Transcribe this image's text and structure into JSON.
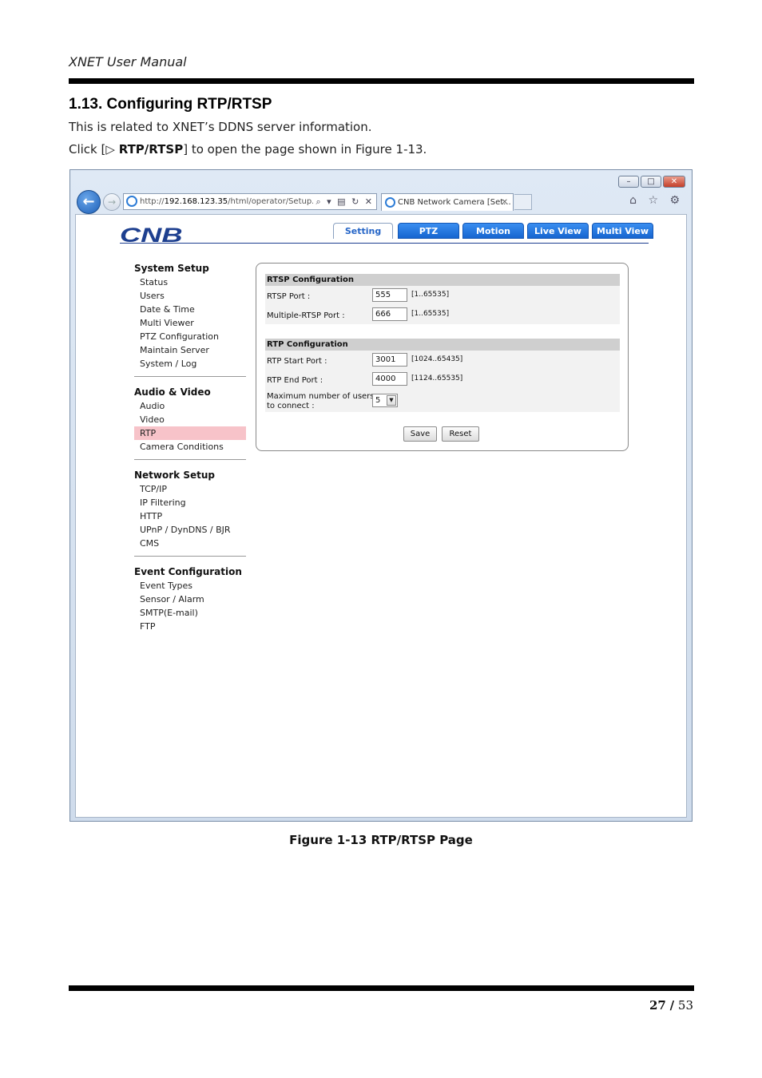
{
  "doc": {
    "header": "XNET User Manual",
    "section_title": "1.13. Configuring RTP/RTSP",
    "para1": "This is related to XNET’s DDNS server information.",
    "para2_pre": "Click [",
    "para2_arrow": "▷",
    "para2_bold": "RTP/RTSP",
    "para2_post": "] to open the page shown in Figure 1-13.",
    "caption": "Figure 1-13 RTP/RTSP Page",
    "page_current": "27",
    "page_sep": "/",
    "page_total": "53"
  },
  "browser": {
    "url_prefix": "http://",
    "url_host": "192.168.123.35",
    "url_path": "/html/operator/Setup.html",
    "tab_title": "CNB Network Camera [Set...",
    "win_min": "–",
    "win_max": "□",
    "win_close": "✕",
    "back_glyph": "←",
    "fwd_glyph": "→",
    "addr_tools": "⌕ ▾ ▤ ↻ ✕",
    "tab_close": "✕",
    "chrome_icons": "⌂ ☆ ⚙"
  },
  "app": {
    "logo": "CNB",
    "nav": [
      "Setting",
      "PTZ",
      "Motion",
      "Live View",
      "Multi View"
    ],
    "menu": [
      {
        "title": "System Setup",
        "items": [
          "Status",
          "Users",
          "Date & Time",
          "Multi Viewer",
          "PTZ Configuration",
          "Maintain Server",
          "System / Log"
        ]
      },
      {
        "title": "Audio & Video",
        "items": [
          "Audio",
          "Video",
          "RTP",
          "Camera Conditions"
        ]
      },
      {
        "title": "Network Setup",
        "items": [
          "TCP/IP",
          "IP Filtering",
          "HTTP",
          "UPnP / DynDNS / BJR",
          "CMS"
        ]
      },
      {
        "title": "Event Configuration",
        "items": [
          "Event Types",
          "Sensor / Alarm",
          "SMTP(E-mail)",
          "FTP"
        ]
      }
    ],
    "rtsp": {
      "heading": "RTSP Configuration",
      "port_label": "RTSP Port :",
      "port_value": "555",
      "port_range": "[1..65535]",
      "multi_label": "Multiple-RTSP Port :",
      "multi_value": "666",
      "multi_range": "[1..65535]"
    },
    "rtp": {
      "heading": "RTP Configuration",
      "start_label": "RTP Start Port :",
      "start_value": "3001",
      "start_range": "[1024..65435]",
      "end_label": "RTP End Port :",
      "end_value": "4000",
      "end_range": "[1124..65535]",
      "max_label_1": "Maximum number of users",
      "max_label_2": "to connect :",
      "max_value": "5",
      "select_arrow": "▼"
    },
    "save": "Save",
    "reset": "Reset"
  }
}
